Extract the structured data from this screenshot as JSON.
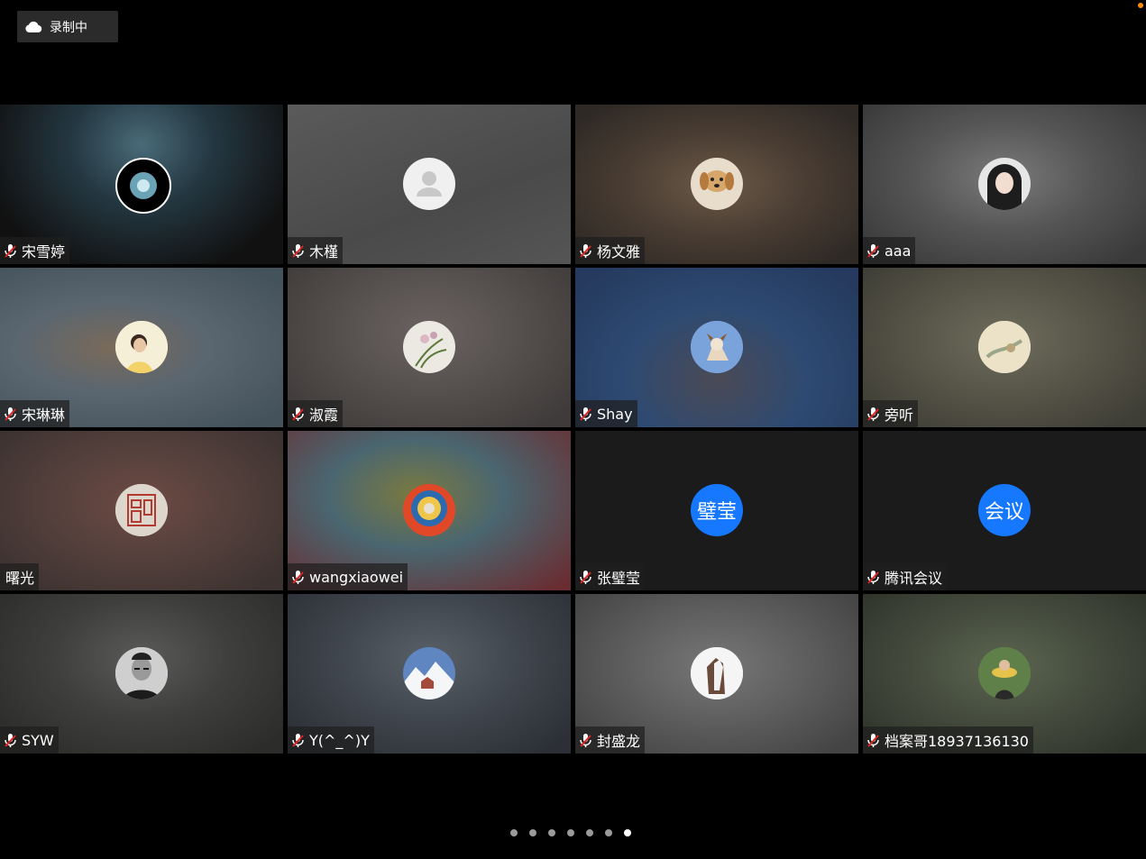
{
  "recording": {
    "label": "录制中",
    "icon": "cloud-icon"
  },
  "participants": [
    {
      "name": "宋雪婷",
      "muted": true,
      "avatar": "dark-orb-avatar"
    },
    {
      "name": "木槿",
      "muted": true,
      "avatar": "default-person-avatar"
    },
    {
      "name": "杨文雅",
      "muted": true,
      "avatar": "puppy-avatar"
    },
    {
      "name": "aaa",
      "muted": true,
      "avatar": "girl-portrait-avatar"
    },
    {
      "name": "宋琳琳",
      "muted": true,
      "avatar": "woman-photo-avatar"
    },
    {
      "name": "淑霞",
      "muted": true,
      "avatar": "orchid-avatar"
    },
    {
      "name": "Shay",
      "muted": true,
      "avatar": "dog-sky-avatar"
    },
    {
      "name": "旁听",
      "muted": true,
      "avatar": "painting-avatar"
    },
    {
      "name": "曙光",
      "muted": false,
      "avatar": "seal-stamp-avatar"
    },
    {
      "name": "wangxiaowei",
      "muted": true,
      "avatar": "colorful-emblem-avatar"
    },
    {
      "name": "张璧莹",
      "muted": true,
      "avatar": "text-avatar",
      "avatar_text": "璧莹"
    },
    {
      "name": "腾讯会议",
      "muted": true,
      "avatar": "text-avatar",
      "avatar_text": "会议"
    },
    {
      "name": "SYW",
      "muted": true,
      "avatar": "man-glasses-avatar"
    },
    {
      "name": "Y(^_^)Y",
      "muted": true,
      "avatar": "snow-landscape-avatar"
    },
    {
      "name": "封盛龙",
      "muted": true,
      "avatar": "horse-avatar"
    },
    {
      "name": "档案哥18937136130",
      "muted": true,
      "avatar": "man-outdoor-avatar"
    }
  ],
  "pagination": {
    "total": 7,
    "active": 7
  },
  "colors": {
    "accent": "#1677ff",
    "recording_dot": "#ff8a00"
  }
}
